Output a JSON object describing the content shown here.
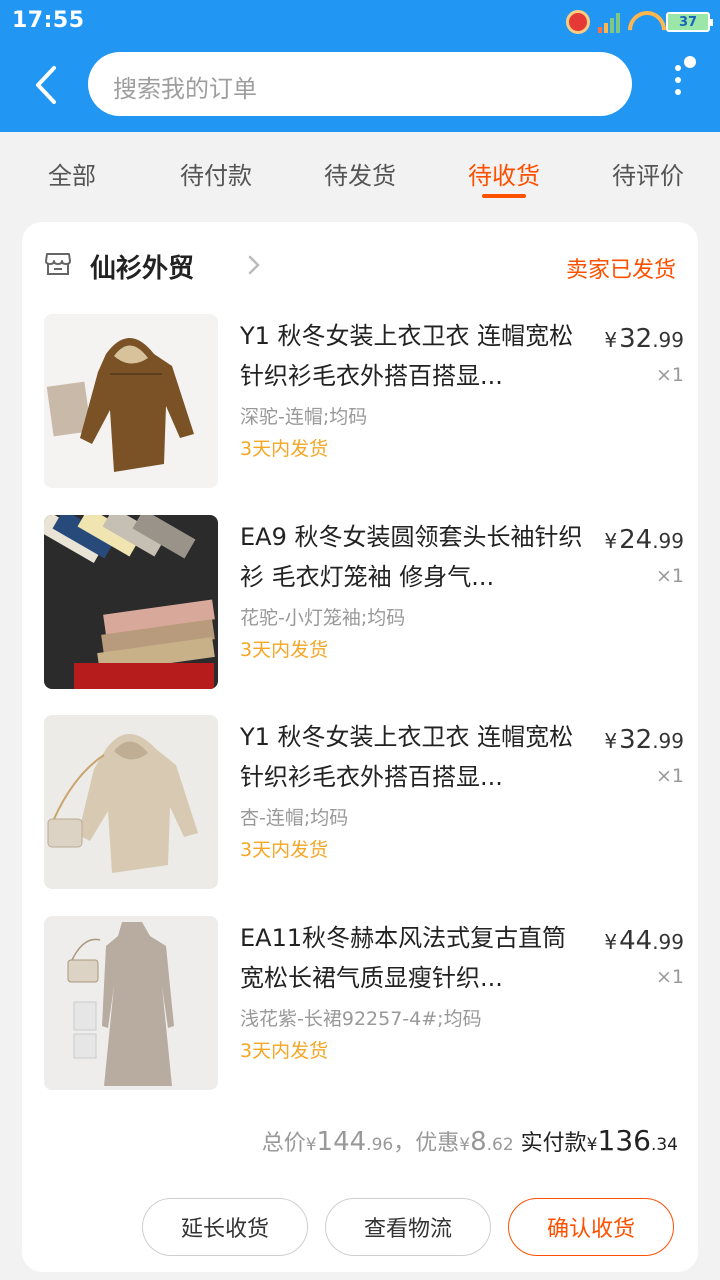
{
  "status_bar": {
    "time": "17:55",
    "battery": "37"
  },
  "header": {
    "search_placeholder": "搜索我的订单"
  },
  "tabs": [
    {
      "label": "全部",
      "active": false
    },
    {
      "label": "待付款",
      "active": false
    },
    {
      "label": "待发货",
      "active": false
    },
    {
      "label": "待收货",
      "active": true
    },
    {
      "label": "待评价",
      "active": false
    }
  ],
  "order": {
    "shop_name": "仙衫外贸",
    "status": "卖家已发货",
    "items": [
      {
        "title": "Y1 秋冬女装上衣卫衣 连帽宽松针织衫毛衣外搭百搭显...",
        "sku": "深驼-连帽;均码",
        "ship_note": "3天内发货",
        "price_int": "32",
        "price_dec": ".99",
        "qty": "×1",
        "image": "brown-hoodie-sweater"
      },
      {
        "title": "EA9 秋冬女装圆领套头长袖针织衫 毛衣灯笼袖 修身气...",
        "sku": "花驼-小灯笼袖;均码",
        "ship_note": "3天内发货",
        "price_int": "24",
        "price_dec": ".99",
        "qty": "×1",
        "image": "stacked-color-sweaters"
      },
      {
        "title": "Y1 秋冬女装上衣卫衣 连帽宽松针织衫毛衣外搭百搭显...",
        "sku": "杏-连帽;均码",
        "ship_note": "3天内发货",
        "price_int": "32",
        "price_dec": ".99",
        "qty": "×1",
        "image": "beige-hoodie-sweater"
      },
      {
        "title": "EA11秋冬赫本风法式复古直筒宽松长裙气质显瘦针织...",
        "sku": "浅花紫-长裙92257-4#;均码",
        "ship_note": "3天内发货",
        "price_int": "44",
        "price_dec": ".99",
        "qty": "×1",
        "image": "long-knit-dress"
      }
    ],
    "totals": {
      "total_label": "总价",
      "total_int": "144",
      "total_dec": ".96",
      "discount_label": "，优惠",
      "discount_int": "8",
      "discount_dec": ".62",
      "paid_label": "实付款",
      "paid_int": "136",
      "paid_dec": ".34",
      "currency": "¥"
    },
    "buttons": {
      "extend": "延长收货",
      "logistics": "查看物流",
      "confirm": "确认收货"
    }
  }
}
